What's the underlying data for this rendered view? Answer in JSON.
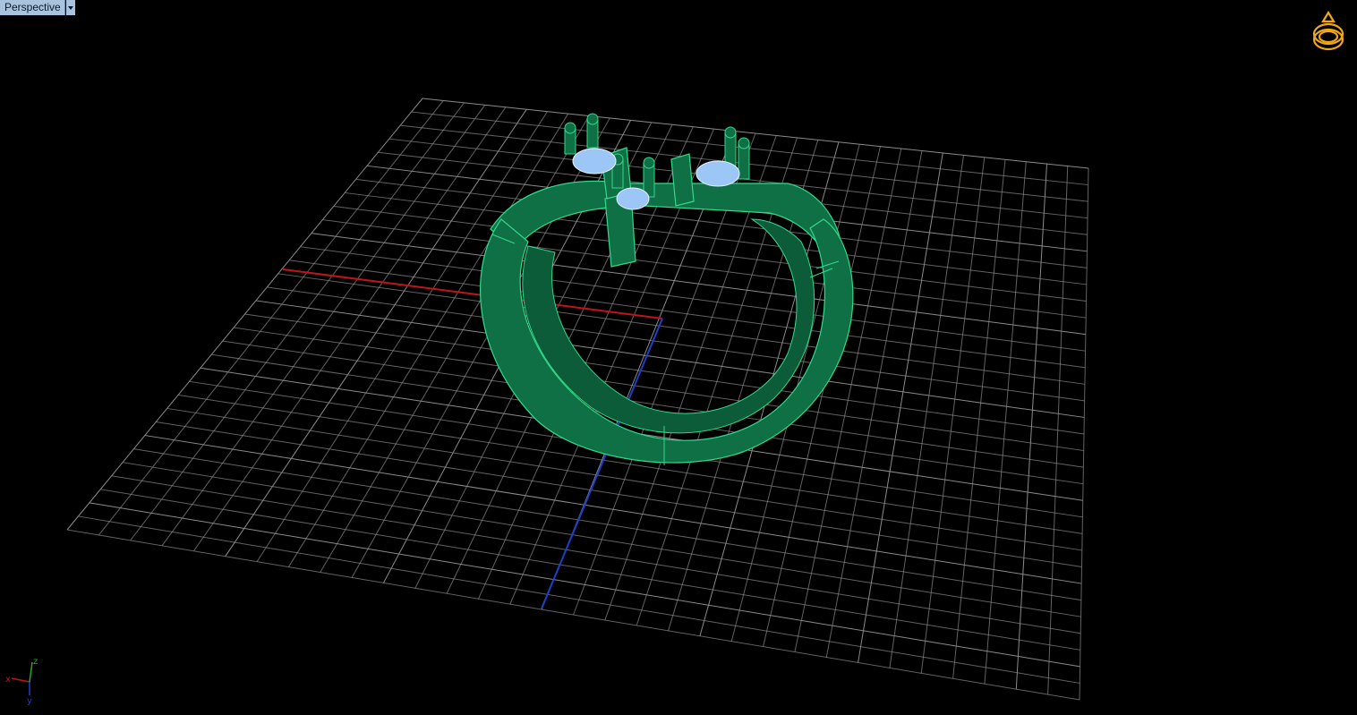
{
  "viewport": {
    "name": "Perspective",
    "background": "#000000"
  },
  "colors": {
    "grid": "#8a8a8a",
    "x_axis": "#c0141c",
    "y_axis": "#1f3fc8",
    "z_axis": "#2aa52a",
    "ring_body": "#0f7046",
    "ring_edge": "#33d98a",
    "gem": "#9cc6f5",
    "gem_edge": "#e6f3ff",
    "view_cube_icon": "#f0a818"
  },
  "icons": {
    "view_indicator": "ring-icon",
    "axis_triad": "axis-triad-icon"
  },
  "axis_triad": {
    "x_label": "x",
    "y_label": "y",
    "z_label": "z"
  }
}
